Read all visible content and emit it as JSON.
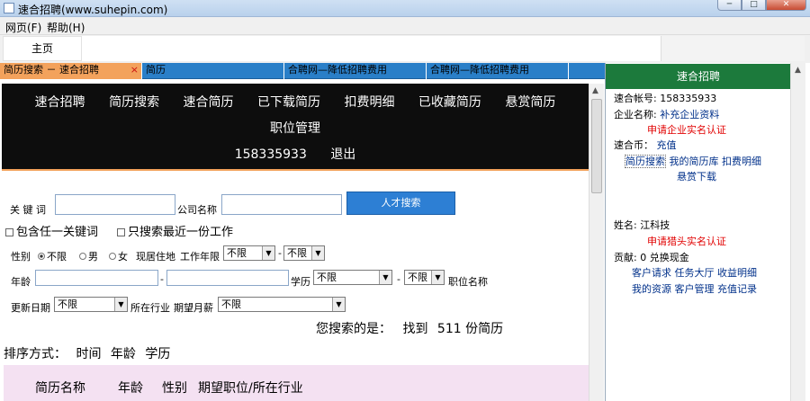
{
  "window": {
    "title": "速合招聘(www.suhepin.com)"
  },
  "menu": {
    "items": [
      "网页(F)",
      "帮助(H)"
    ]
  },
  "nav": {
    "home": "主页"
  },
  "tabs": [
    {
      "label": "简历搜索 － 速合招聘",
      "active": true
    },
    {
      "label": "简历",
      "active": false
    },
    {
      "label": "合聘网—降低招聘费用",
      "active": false
    },
    {
      "label": "合聘网—降低招聘费用",
      "active": false
    }
  ],
  "site_nav": {
    "row1": [
      "速合招聘",
      "简历搜索",
      "速合简历",
      "已下载简历",
      "扣费明细",
      "已收藏简历",
      "悬赏简历"
    ],
    "row2": "职位管理",
    "account": "158335933",
    "logout": "退出"
  },
  "search": {
    "keyword_label": "关 键 词",
    "keyword_value": "",
    "company_label": "公司名称",
    "company_value": "",
    "submit": "人才搜索",
    "any_keyword": "包含任一关键词",
    "latest_only": "只搜索最近一份工作",
    "gender_label": "性别",
    "gender_options": [
      "不限",
      "男",
      "女"
    ],
    "gender_selected": "不限",
    "location_label": "现居住地",
    "years_label": "工作年限",
    "years_from": "不限",
    "years_to": "不限",
    "age_label": "年龄",
    "dash": "-",
    "edu_label": "学历",
    "edu_from": "不限",
    "edu_to": "不限",
    "position_label": "职位名称",
    "updated_label": "更新日期",
    "updated_value": "不限",
    "industry_label": "所在行业",
    "salary_label": "期望月薪",
    "salary_value": "不限",
    "found_prefix": "您搜索的是：",
    "found_text": "找到",
    "found_count": "511",
    "found_suffix": "份简历"
  },
  "sort": {
    "label": "排序方式：",
    "options": [
      "时间",
      "年龄",
      "学历"
    ]
  },
  "table": {
    "headers": [
      "简历名称",
      "年龄",
      "性别",
      "期望职位/所在行业"
    ]
  },
  "panel": {
    "title": "速合招聘",
    "account_label": "速合帐号:",
    "account_value": "158335933",
    "company_label": "企业名称:",
    "company_link": "补充企业资料",
    "company_verify": "申请企业实名认证",
    "coins_label": "速合币：",
    "coins_link": "充值",
    "links1": [
      "简历搜索",
      "我的简历库",
      "扣费明细"
    ],
    "links1b": "悬赏下载",
    "name_label": "姓名:",
    "name_value": "江科技",
    "hunter_verify": "申请猎头实名认证",
    "contrib": "贡献: 0 兑换现金",
    "links2": [
      "客户请求",
      "任务大厅",
      "收益明细"
    ],
    "links3": [
      "我的资源",
      "客户管理",
      "充值记录"
    ]
  },
  "colors": {
    "tab_bar": "#2a7fc8",
    "active_tab": "#f3a25c",
    "panel_header": "#1c7a3c",
    "button": "#2d7fd4",
    "alert": "#e10000"
  }
}
